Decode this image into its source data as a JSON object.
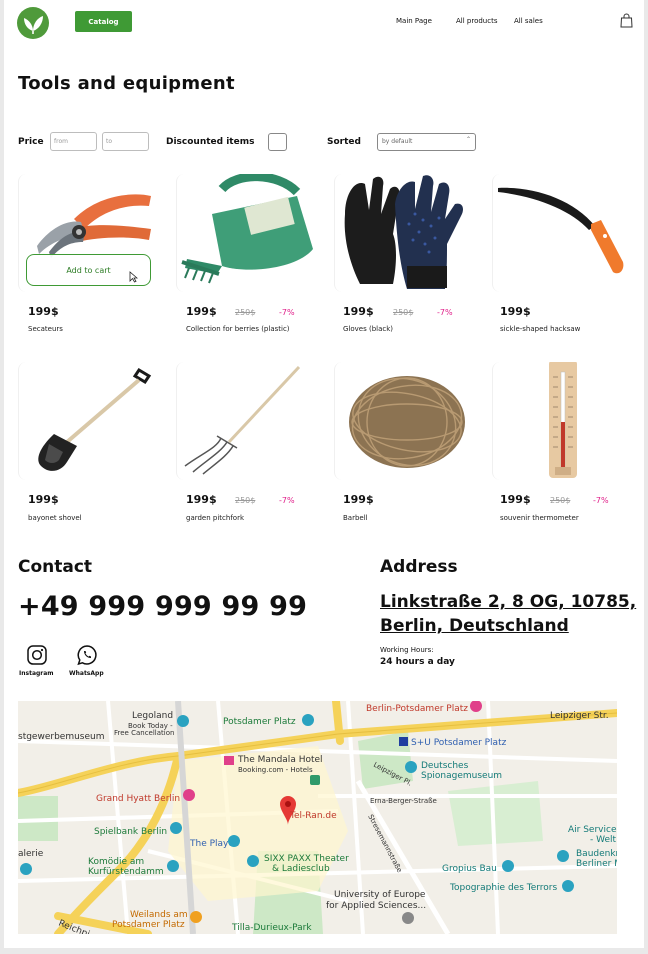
{
  "header": {
    "catalog_label": "Catalog",
    "nav": [
      "Main Page",
      "All products",
      "All sales"
    ]
  },
  "page_title": "Tools and equipment",
  "filters": {
    "price_label": "Price",
    "from_placeholder": "from",
    "to_placeholder": "to",
    "discounted_label": "Discounted items",
    "sorted_label": "Sorted",
    "sorted_value": "by default"
  },
  "add_to_cart_label": "Add to cart",
  "products": [
    {
      "name": "Secateurs",
      "price": "199$",
      "old_price": "",
      "discount": ""
    },
    {
      "name": "Collection for berries (plastic)",
      "price": "199$",
      "old_price": "250$",
      "discount": "-7%"
    },
    {
      "name": "Gloves (black)",
      "price": "199$",
      "old_price": "250$",
      "discount": "-7%"
    },
    {
      "name": "sickle-shaped hacksaw",
      "price": "199$",
      "old_price": "",
      "discount": ""
    },
    {
      "name": "bayonet shovel",
      "price": "199$",
      "old_price": "",
      "discount": ""
    },
    {
      "name": "garden pitchfork",
      "price": "199$",
      "old_price": "250$",
      "discount": "-7%"
    },
    {
      "name": "Barbell",
      "price": "199$",
      "old_price": "",
      "discount": ""
    },
    {
      "name": "souvenir thermometer",
      "price": "199$",
      "old_price": "250$",
      "discount": "-7%"
    }
  ],
  "contact": {
    "title": "Contact",
    "phone": "+49 999 999 99 99",
    "instagram_label": "Instagram",
    "whatsapp_label": "WhatsApp"
  },
  "address": {
    "title": "Address",
    "line1": "Linkstraße 2, 8 OG, 10785,",
    "line2": "Berlin, Deutschland",
    "hours_label": "Working Hours:",
    "hours_value": "24 hours a day"
  },
  "map": {
    "labels": [
      "Legoland",
      "Book Today -",
      "Free Cancellation",
      "stgewerbemuseum",
      "Potsdamer Platz",
      "Berlin-Potsdamer Platz",
      "Leipziger Str.",
      "S+U Potsdamer Platz",
      "The Mandala Hotel",
      "Booking.com - Hotels",
      "Leipziger Pl.",
      "Deutsches",
      "Spionagemuseum",
      "Grand Hyatt Berlin",
      "Erna-Berger-Straße",
      "Tel-Ran.de",
      "Spielbank Berlin",
      "The Playce",
      "Stresemannstraße",
      "Air Service",
      "- Welt",
      "Baudenkm",
      "Berliner M",
      "alerie",
      "Komödie am",
      "Kurfürstendamm",
      "SIXX PAXX Theater",
      "& Ladiesclub",
      "Gropius Bau",
      "Topographie des Terrors",
      "University of Europe",
      "for Applied Sciences...",
      "Weilands am",
      "Potsdamer Platz",
      "Tilla-Durieux-Park",
      "Reichpi"
    ]
  },
  "colors": {
    "brand_green": "#3f9a35",
    "discount_pink": "#e0208a"
  }
}
